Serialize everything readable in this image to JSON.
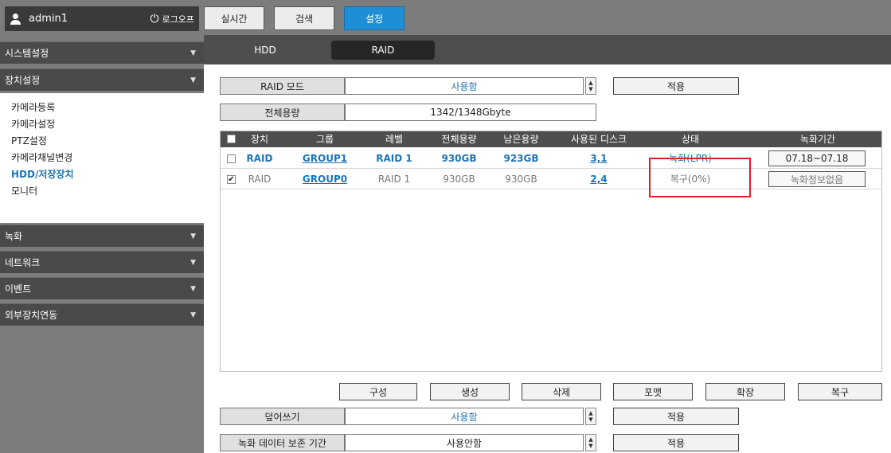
{
  "user": {
    "name": "admin1",
    "icon": "user-icon"
  },
  "logout": {
    "label": "로그오프",
    "icon": "power-icon"
  },
  "tabs": [
    {
      "label": "실시간"
    },
    {
      "label": "검색"
    },
    {
      "label": "설정",
      "active": true
    }
  ],
  "subtabs": [
    {
      "label": "HDD"
    },
    {
      "label": "RAID",
      "active": true
    }
  ],
  "sidebar": {
    "sections": [
      {
        "label": "시스템설정"
      },
      {
        "label": "장치설정",
        "expanded": true
      },
      {
        "label": "녹화"
      },
      {
        "label": "네트워크"
      },
      {
        "label": "이벤트"
      },
      {
        "label": "외부장치연동"
      }
    ],
    "subitems": [
      {
        "label": "카메라등록"
      },
      {
        "label": "카메라설정"
      },
      {
        "label": "PTZ설정"
      },
      {
        "label": "카메라채널변경"
      },
      {
        "label": "HDD/저장장치",
        "active": true
      },
      {
        "label": "모니터"
      }
    ]
  },
  "raid_mode": {
    "label": "RAID 모드",
    "value": "사용함",
    "apply": "적용"
  },
  "capacity": {
    "label": "전체용량",
    "value": "1342/1348Gbyte"
  },
  "table": {
    "headers": [
      "장치",
      "그룹",
      "레벨",
      "전체용량",
      "남은용량",
      "사용된 디스크",
      "상태",
      "녹화기간"
    ],
    "rows": [
      {
        "checked": false,
        "device": "RAID",
        "group": "GROUP1",
        "level": "RAID 1",
        "total": "930GB",
        "free": "923GB",
        "disks": "3,1",
        "status": "녹화(LPR)",
        "period": "07.18~07.18"
      },
      {
        "checked": true,
        "device": "RAID",
        "group": "GROUP0",
        "level": "RAID 1",
        "total": "930GB",
        "free": "930GB",
        "disks": "2,4",
        "status": "복구(0%)",
        "period": "녹화정보없음"
      }
    ]
  },
  "actions": [
    "구성",
    "생성",
    "삭제",
    "포맷",
    "확장",
    "복구"
  ],
  "overwrite": {
    "label": "덮어쓰기",
    "value": "사용함",
    "apply": "적용"
  },
  "retention": {
    "label": "녹화 데이터 보존 기간",
    "value": "사용안함",
    "apply": "적용"
  },
  "colors": {
    "accent": "#1e8fd6",
    "link": "#1e73b6",
    "highlight": "#e02020"
  }
}
